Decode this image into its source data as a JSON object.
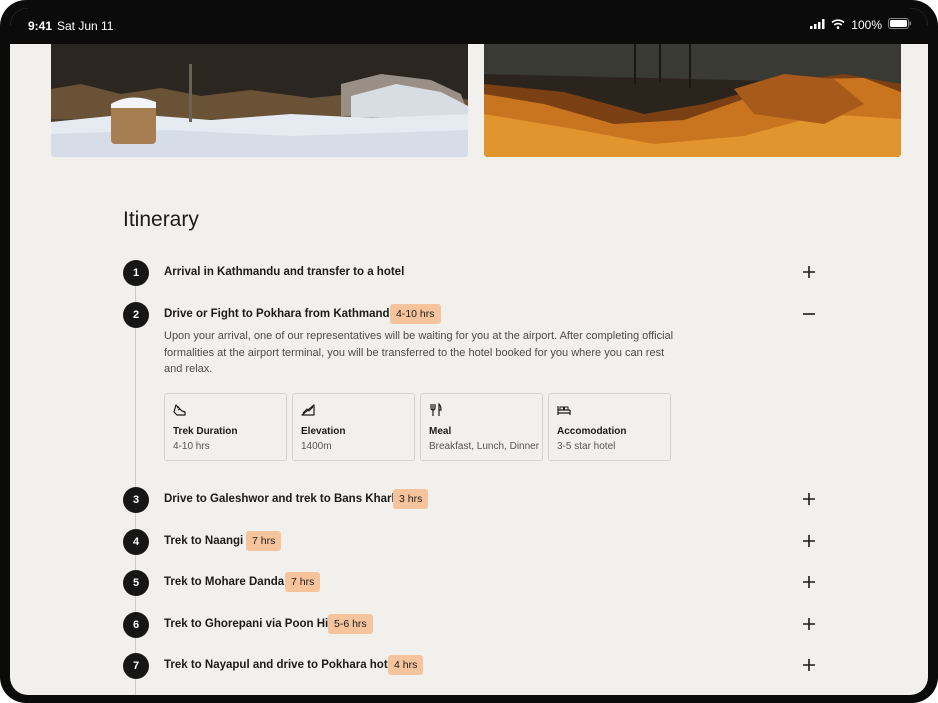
{
  "status_bar": {
    "time": "9:41",
    "date": "Sat Jun 11",
    "battery": "100%"
  },
  "photos": [
    {
      "name": "snowy-forest-photo"
    },
    {
      "name": "golden-hillside-photo"
    }
  ],
  "itinerary": {
    "title": "Itinerary",
    "days": [
      {
        "num": "1",
        "title": "Arrival in Kathmandu and transfer to a hotel",
        "badge": "",
        "expanded": false
      },
      {
        "num": "2",
        "title": "Drive or Fight to Pokhara from Kathmandu:",
        "badge": "4-10 hrs",
        "expanded": true
      },
      {
        "num": "3",
        "title": "Drive to Galeshwor and trek to Bans Kharka",
        "badge": "3 hrs",
        "expanded": false
      },
      {
        "num": "4",
        "title": "Trek to Naangi",
        "badge": "7 hrs",
        "expanded": false
      },
      {
        "num": "5",
        "title": "Trek to Mohare Danda",
        "badge": "7 hrs",
        "expanded": false
      },
      {
        "num": "6",
        "title": "Trek to Ghorepani via Poon Hill",
        "badge": "5-6 hrs",
        "expanded": false
      },
      {
        "num": "7",
        "title": "Trek to Nayapul and drive to Pokhara hotel",
        "badge": "4 hrs",
        "expanded": false
      }
    ],
    "expanded_detail": {
      "description": "Upon your arrival, one of our representatives will be waiting for you at the airport. After completing official formalities at the airport terminal, you will be transferred to the hotel booked for you where you can rest and relax.",
      "cards": [
        {
          "icon": "hiking-boot-icon",
          "label": "Trek Duration",
          "value": "4-10 hrs"
        },
        {
          "icon": "elevation-icon",
          "label": "Elevation",
          "value": "1400m"
        },
        {
          "icon": "fork-knife-icon",
          "label": "Meal",
          "value": "Breakfast, Lunch, Dinner"
        },
        {
          "icon": "bed-icon",
          "label": "Accomodation",
          "value": "3-5 star hotel"
        }
      ]
    }
  },
  "colors": {
    "background": "#f2f0ec",
    "badge": "#f6c49c",
    "number_circle": "#161616",
    "text": "#1b1b1b"
  }
}
